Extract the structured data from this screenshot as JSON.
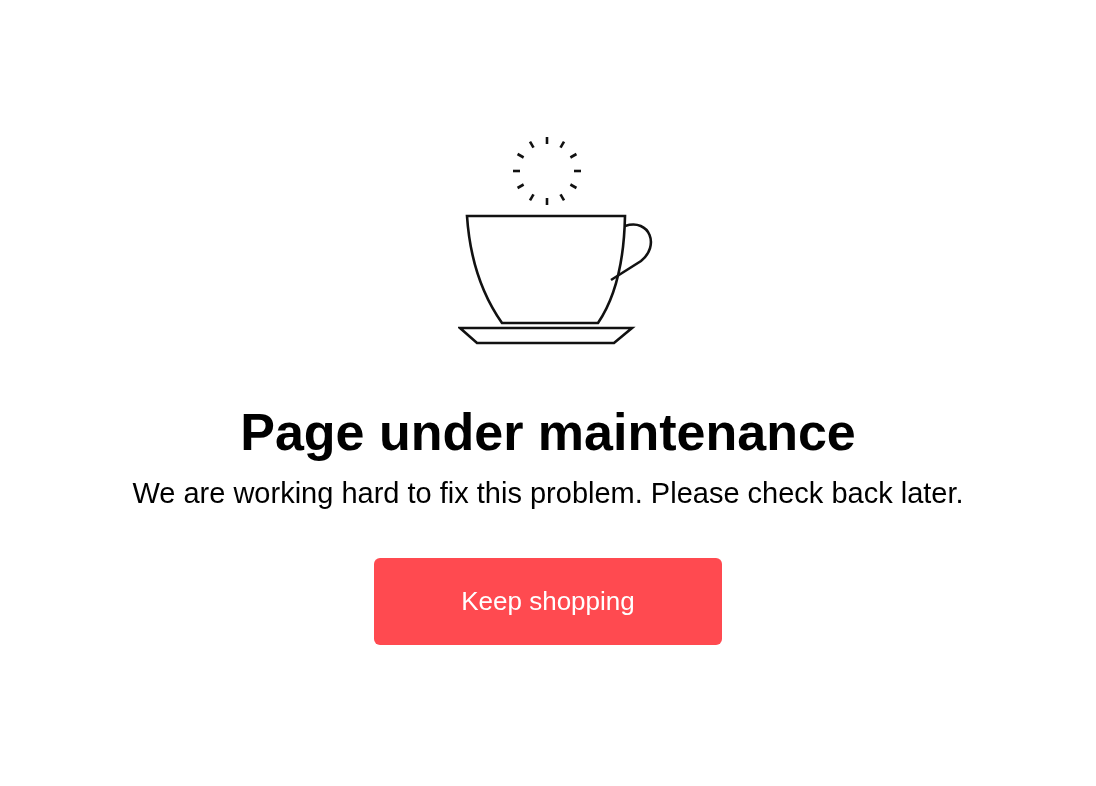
{
  "title": "Page under maintenance",
  "message": "We are working hard to fix this problem. Please check back later.",
  "button": {
    "label": "Keep shopping"
  }
}
